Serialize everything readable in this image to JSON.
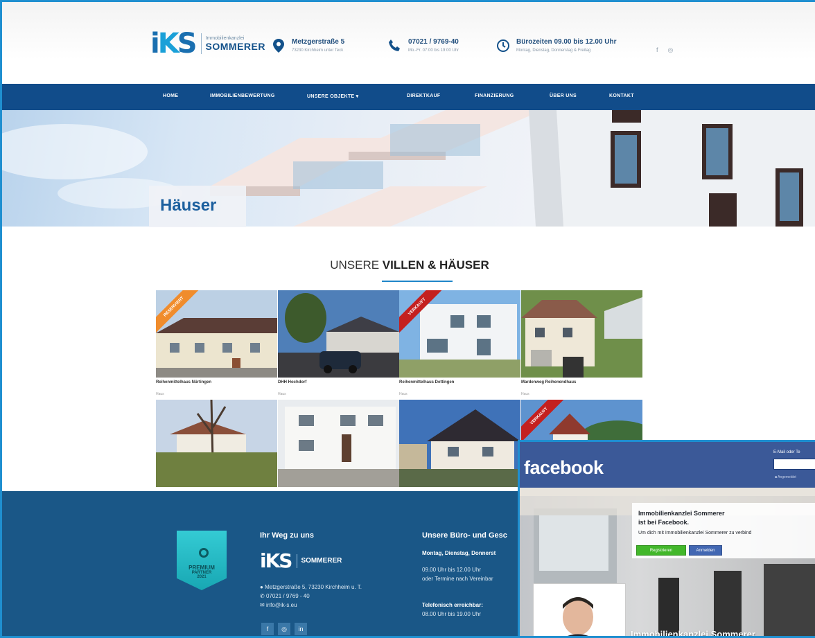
{
  "header": {
    "logo_small": "Immobilienkanzlei",
    "logo_name": "SOMMERER",
    "address_line1": "Metzgerstraße 5",
    "address_line2": "73230 Kirchheim unter Teck",
    "phone_line1": "07021 / 9769-40",
    "phone_line2": "Mo.-Fr. 07:00 bis 19:00 Uhr",
    "hours_line1": "Bürozeiten 09.00 bis 12.00 Uhr",
    "hours_line2": "Montag, Dienstag, Donnerstag & Freitag",
    "social": [
      "f",
      "◎"
    ]
  },
  "nav": {
    "home": "HOME",
    "valuation": "IMMOBILIENBEWERTUNG",
    "objects": "UNSERE OBJEKTE",
    "direct": "DIREKTKAUF",
    "finance": "FINANZIERUNG",
    "about": "ÜBER UNS",
    "contact": "KONTAKT"
  },
  "hero": {
    "title": "Häuser"
  },
  "section": {
    "title_pre": "UNSERE ",
    "title_bold": "VILLEN & HÄUSER"
  },
  "properties": [
    {
      "title": "Reihenmittelhaus Nürtingen",
      "sub": "Haus",
      "ribbon": "RESERVIERT"
    },
    {
      "title": "DHH Hochdorf",
      "sub": "Haus",
      "ribbon": ""
    },
    {
      "title": "Reihenmittelhaus Dettingen",
      "sub": "Haus",
      "ribbon": "VERKAUFT"
    },
    {
      "title": "Mardenweg Reihenendhaus",
      "sub": "Haus",
      "ribbon": ""
    },
    {
      "title": "",
      "sub": "",
      "ribbon": ""
    },
    {
      "title": "",
      "sub": "",
      "ribbon": ""
    },
    {
      "title": "",
      "sub": "",
      "ribbon": ""
    },
    {
      "title": "",
      "sub": "",
      "ribbon": "VERKAUFT"
    }
  ],
  "footer": {
    "badge": [
      "PREMIUM",
      "PARTNER",
      "2021"
    ],
    "col1_heading": "Ihr Weg zu uns",
    "logo_name": "SOMMERER",
    "address": "Metzgerstraße 5, 73230 Kirchheim u. T.",
    "phone": "07021 / 9769 - 40",
    "email": "info@ik-s.eu",
    "col2_heading": "Unsere Büro- und Gesc",
    "days": "Montag, Dienstag, Donnerst",
    "hours1": "09.00 Uhr bis 12.00 Uhr",
    "hours2": "oder Termine nach Vereinbar",
    "phone_label": "Telefonisch erreichbar:",
    "phone_hours": "08.00 Uhr bis 19.00 Uhr",
    "social": [
      "f",
      "◎",
      "in"
    ]
  },
  "facebook": {
    "logo": "facebook",
    "email_label": "E-Mail oder Te",
    "remember": "Angemeldet",
    "page_name_line1": "Immobilienkanzlei Sommerer",
    "page_name_line2": "ist bei Facebook.",
    "message": "Um dich mit Immobilienkanzlei Sommerer zu verbind",
    "register": "Registrieren",
    "login": "Anmelden",
    "page_title": "Immobilienkanzlei Sommerer"
  },
  "colors": {
    "nav": "#114c8a",
    "footer": "#1a5787",
    "accent": "#1f86c9",
    "facebook": "#3b5998",
    "reserved": "#f08c2c",
    "sold": "#c4201f"
  }
}
